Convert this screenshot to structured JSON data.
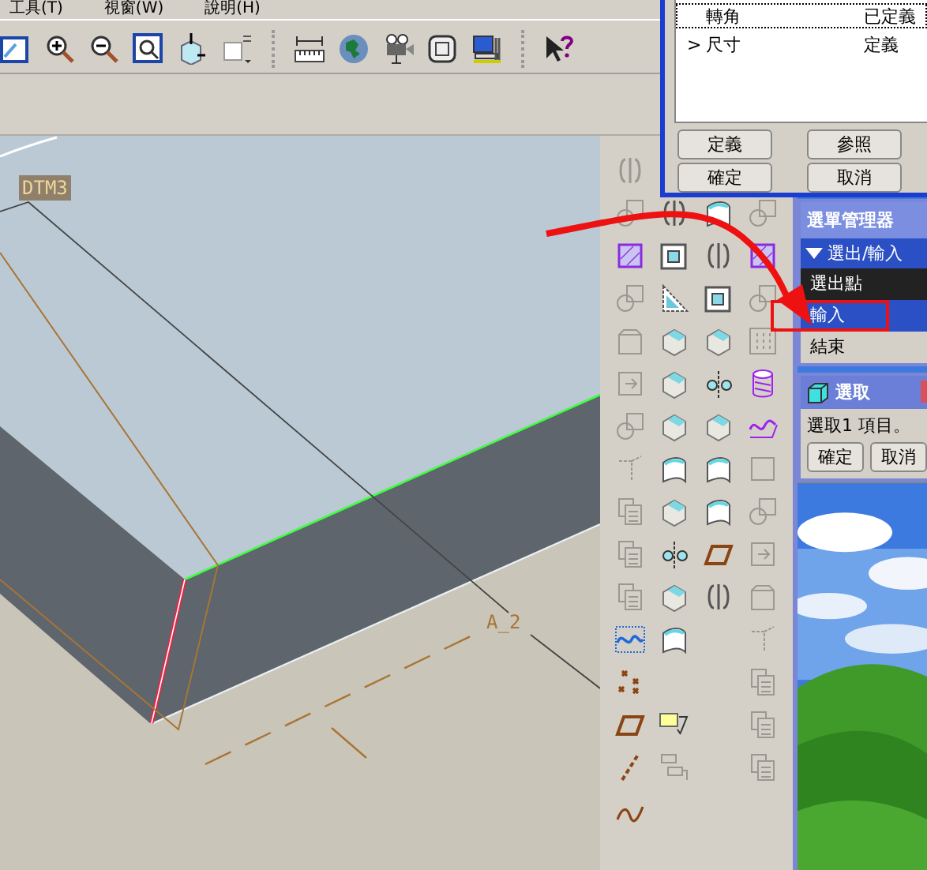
{
  "menu_bar": {
    "items": [
      "工具(T)",
      "視窗(W)",
      "說明(H)"
    ]
  },
  "viewport": {
    "labels": [
      {
        "kind": "datum",
        "text": "DTM3"
      },
      {
        "kind": "axis",
        "text": "A_2"
      }
    ]
  },
  "feature_dialog": {
    "rows": [
      {
        "marker": "",
        "name": "轉角",
        "status": "已定義",
        "selected": true
      },
      {
        "marker": ">",
        "name": "尺寸",
        "status": "定義",
        "selected": false
      }
    ],
    "buttons": [
      "定義",
      "參照",
      "確定",
      "取消"
    ]
  },
  "menu_manager": {
    "title": "選單管理器",
    "header": "選出/輸入",
    "items": [
      {
        "label": "選出點",
        "selected": false,
        "highlighted": true
      },
      {
        "label": "輸入",
        "selected": true,
        "highlighted": false
      },
      {
        "label": "結束",
        "selected": false,
        "highlighted": false
      }
    ]
  },
  "select_dialog": {
    "title": "選取",
    "message": "選取1 項目。",
    "buttons": [
      "確定",
      "取消"
    ]
  }
}
